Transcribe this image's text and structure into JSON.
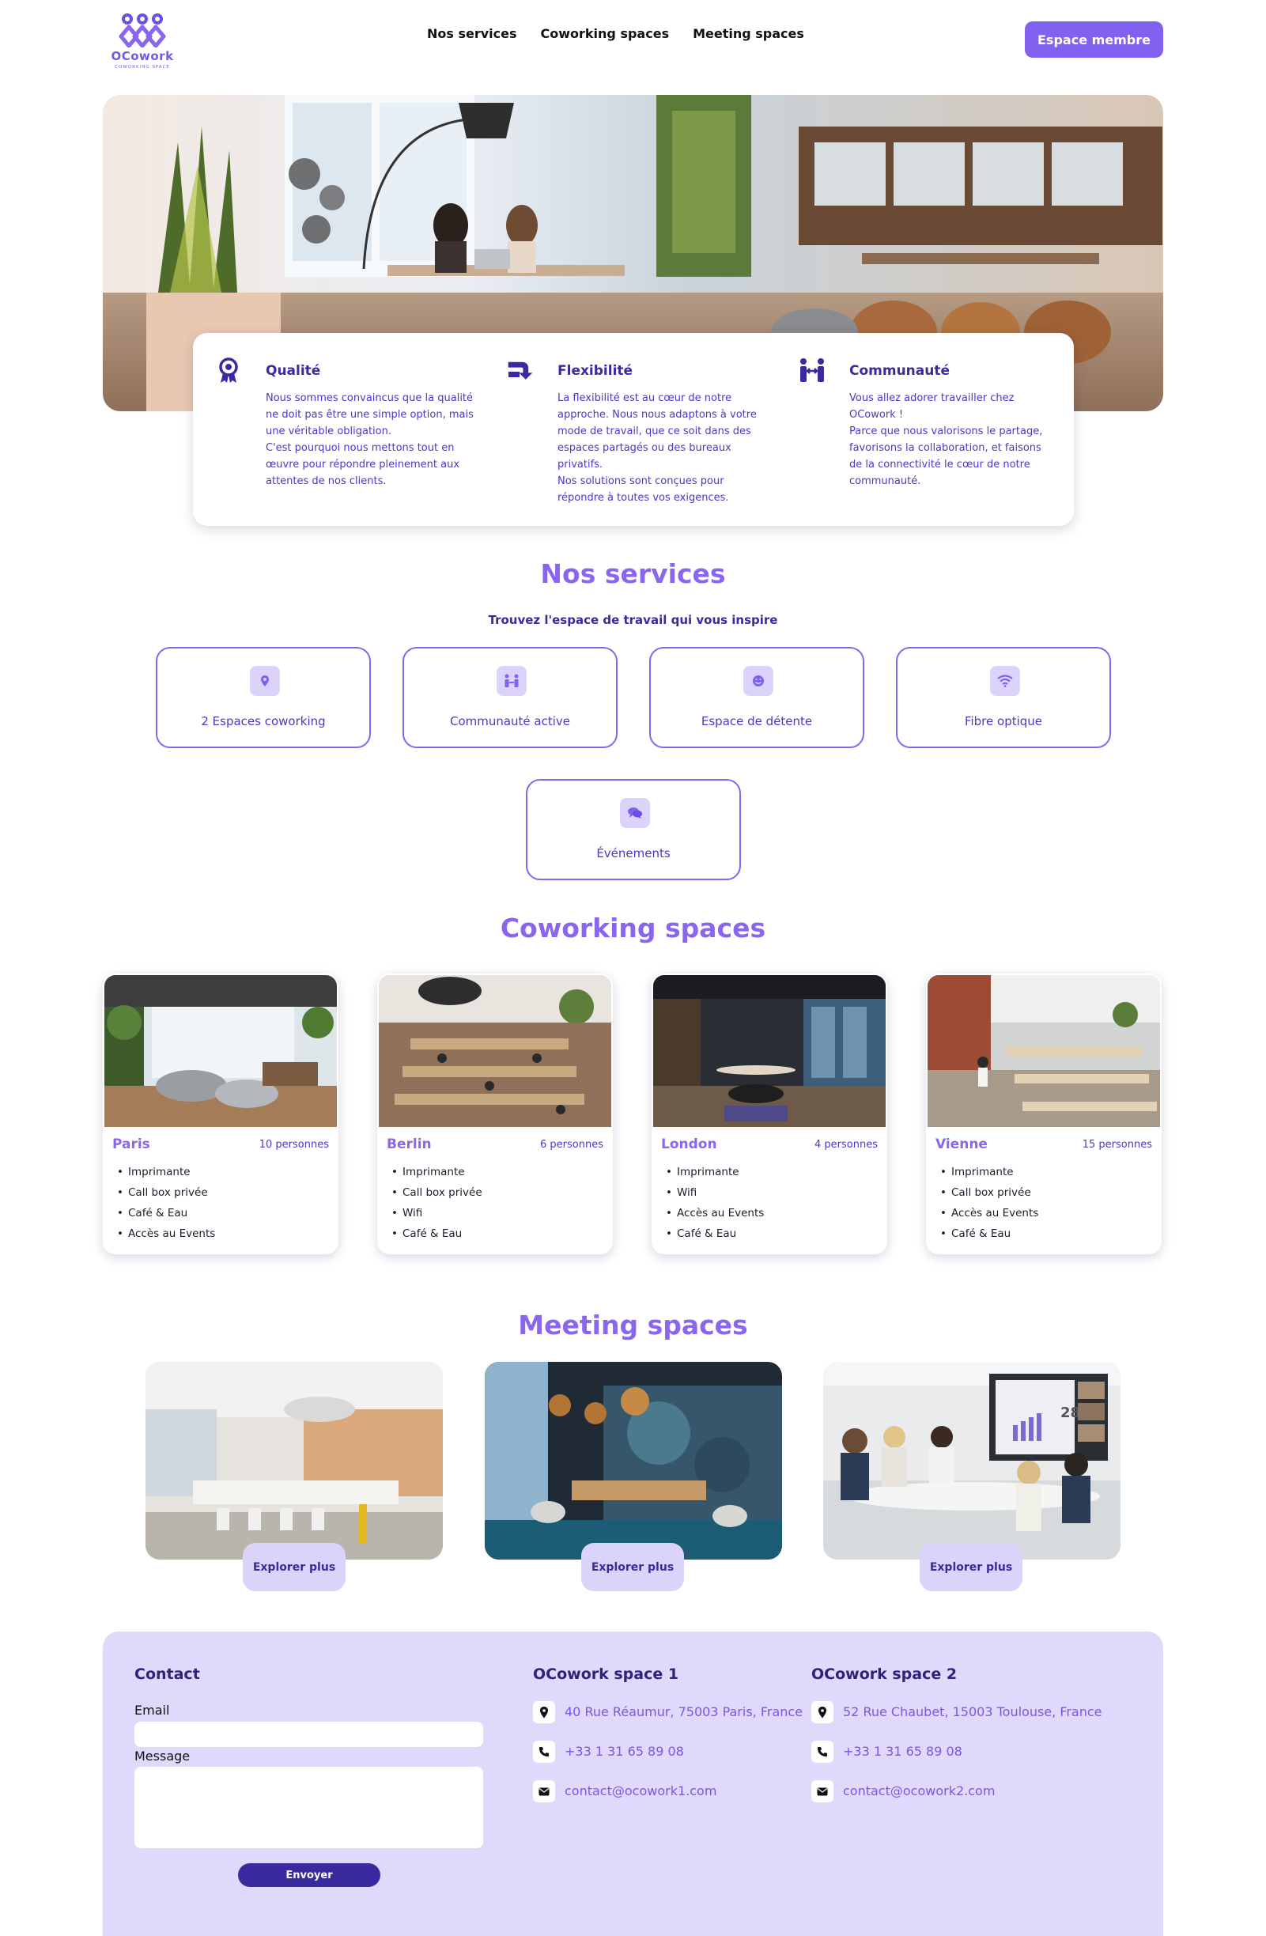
{
  "brand": {
    "name": "OCowork",
    "tagline": "COWORKING SPACE"
  },
  "nav": {
    "items": [
      "Nos services",
      "Coworking spaces",
      "Meeting spaces"
    ],
    "member_button": "Espace membre"
  },
  "values": [
    {
      "icon": "award-ribbon-icon",
      "title": "Qualité",
      "text": "Nous sommes convaincus que la qualité\nne doit pas être une simple option, mais\nune véritable obligation.\nC'est pourquoi nous mettons tout en\nœuvre pour répondre pleinement aux\nattentes de nos clients."
    },
    {
      "icon": "flexible-arrow-icon",
      "title": "Flexibilité",
      "text": "La flexibilité est au cœur de notre\napproche. Nous nous adaptons à votre\nmode de travail, que ce soit dans des\nespaces partagés ou des bureaux\nprivatifs.\nNos solutions sont conçues pour\nrépondre à toutes vos exigences."
    },
    {
      "icon": "people-community-icon",
      "title": "Communauté",
      "text": "Vous allez adorer travailler chez\nOCowork !\nParce que nous valorisons le partage,\nfavorisons la collaboration, et faisons\nde la connectivité le cœur de notre\ncommunauté."
    }
  ],
  "services": {
    "title": "Nos services",
    "subtitle": "Trouvez l'espace de travail qui vous inspire",
    "items": [
      {
        "icon": "location-pin-icon",
        "label": "2 Espaces coworking"
      },
      {
        "icon": "people-icon",
        "label": "Communauté active"
      },
      {
        "icon": "smiley-icon",
        "label": "Espace de détente"
      },
      {
        "icon": "wifi-icon",
        "label": "Fibre optique"
      },
      {
        "icon": "chat-bubbles-icon",
        "label": "Événements"
      }
    ]
  },
  "coworking": {
    "title": "Coworking spaces",
    "spaces": [
      {
        "city": "Paris",
        "capacity": "10 personnes",
        "features": [
          "Imprimante",
          "Call box privée",
          "Café & Eau",
          "Accès au Events"
        ]
      },
      {
        "city": "Berlin",
        "capacity": "6 personnes",
        "features": [
          "Imprimante",
          "Call box privée",
          "Wifi",
          "Café & Eau"
        ]
      },
      {
        "city": "London",
        "capacity": "4 personnes",
        "features": [
          "Imprimante",
          "Wifi",
          "Accès au Events",
          "Café & Eau"
        ]
      },
      {
        "city": "Vienne",
        "capacity": "15 personnes",
        "features": [
          "Imprimante",
          "Call box privée",
          "Accès au Events",
          "Café & Eau"
        ]
      }
    ]
  },
  "meeting": {
    "title": "Meeting spaces",
    "button_label": "Explorer plus",
    "screen_number": "28"
  },
  "contact": {
    "title": "Contact",
    "email_label": "Email",
    "message_label": "Message",
    "send_button": "Envoyer",
    "email_value": "",
    "message_value": ""
  },
  "locations": [
    {
      "name": "OCowork space 1",
      "address": "40 Rue Réaumur, 75003 Paris, France",
      "phone": "+33 1 31 65 89 08",
      "email": "contact@ocowork1.com"
    },
    {
      "name": "OCowork space 2",
      "address": "52 Rue Chaubet, 15003 Toulouse, France",
      "phone": "+33 1 31 65 89 08",
      "email": "contact@ocowork2.com"
    }
  ],
  "colors": {
    "accent": "#8162f0",
    "accent_dark": "#3a2aa0",
    "lavender": "#e0d9fb",
    "icon_bg": "#dcd3fb"
  }
}
